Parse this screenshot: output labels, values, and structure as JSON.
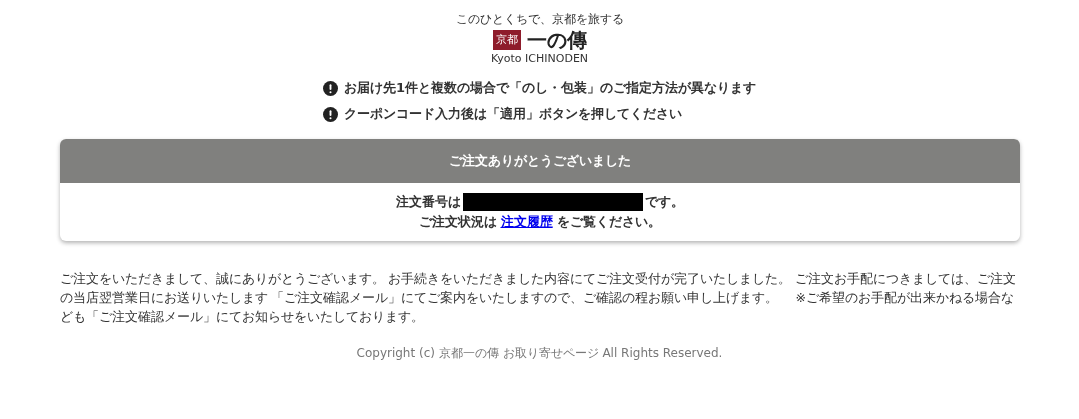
{
  "logo": {
    "tagline": "このひとくちで、京都を旅する",
    "badge": "京都",
    "name": "一の傳",
    "romaji": "Kyoto ICHINODEN"
  },
  "notices": [
    "お届け先1件と複数の場合で「のし・包装」のご指定方法が異なります",
    "クーポンコード入力後は「適用」ボタンを押してください"
  ],
  "card": {
    "title": "ご注文ありがとうございました",
    "order_label": "注文番号は",
    "order_suffix": "です。",
    "status_prefix": "ご注文状況は",
    "status_link": "注文履歴",
    "status_suffix": "をご覧ください。"
  },
  "message": "ご注文をいただきまして、誠にありがとうございます。 お手続きをいただきました内容にてご注文受付が完了いたしました。 ご注文お手配につきましては、ご注文の当店翌営業日にお送りいたします 「ご注文確認メール」にてご案内をいたしますので、ご確認の程お願い申し上げます。　 ※ご希望のお手配が出来かねる場合なども「ご注文確認メール」にてお知らせをいたしております。",
  "footer": "Copyright (c) 京都一の傳 お取り寄せページ All Rights Reserved."
}
